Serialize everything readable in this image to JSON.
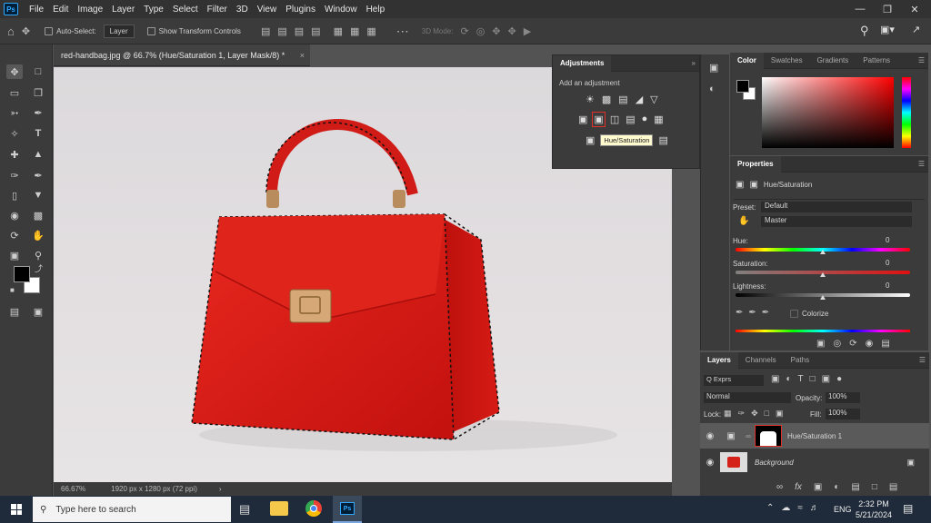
{
  "menubar": {
    "logo": "Ps",
    "items": [
      "File",
      "Edit",
      "Image",
      "Layer",
      "Type",
      "Select",
      "Filter",
      "3D",
      "View",
      "Plugins",
      "Window",
      "Help"
    ]
  },
  "options": {
    "auto_select_label": "Auto-Select:",
    "auto_select_value": "Layer",
    "transform_label": "Show Transform Controls",
    "mode_3d": "3D Mode:"
  },
  "document": {
    "tab_title": "red-handbag.jpg @ 66.7% (Hue/Saturation 1, Layer Mask/8) *",
    "zoom": "66.67%",
    "size_info": "1920 px x 1280 px (72 ppi)"
  },
  "adjustments": {
    "title": "Adjustments",
    "subtitle": "Add an adjustment",
    "tooltip": "Hue/Saturation"
  },
  "color_panel": {
    "tabs": [
      "Color",
      "Swatches",
      "Gradients",
      "Patterns"
    ]
  },
  "properties": {
    "title": "Properties",
    "layer_type": "Hue/Saturation",
    "preset_label": "Preset:",
    "preset_value": "Default",
    "channel_value": "Master",
    "hue_label": "Hue:",
    "hue_value": "0",
    "saturation_label": "Saturation:",
    "saturation_value": "0",
    "lightness_label": "Lightness:",
    "lightness_value": "0",
    "colorize_label": "Colorize"
  },
  "layers_panel": {
    "tabs": [
      "Layers",
      "Channels",
      "Paths"
    ],
    "filter_value": "Q Exprs",
    "blend_mode": "Normal",
    "opacity_label": "Opacity:",
    "opacity_value": "100%",
    "lock_label": "Lock:",
    "fill_label": "Fill:",
    "fill_value": "100%",
    "layers": [
      {
        "name": "Hue/Saturation 1"
      },
      {
        "name": "Background"
      }
    ]
  },
  "taskbar": {
    "search_placeholder": "Type here to search",
    "language": "ENG",
    "time": "2:32 PM",
    "date": "5/21/2024"
  }
}
